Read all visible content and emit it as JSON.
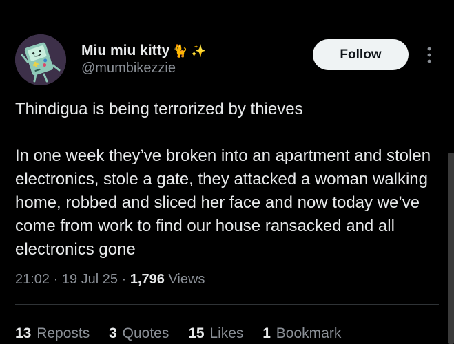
{
  "author": {
    "name": "Miu miu kitty",
    "name_emoji_1": "🐈",
    "name_emoji_2": "✨",
    "handle": "@mumbikezzie",
    "avatar_icon": "bmo-avatar-icon"
  },
  "follow_label": "Follow",
  "more_icon": "more-vertical-icon",
  "tweet": {
    "paragraph_1": "Thindigua is being terrorized by thieves",
    "paragraph_2": "In one week they’ve broken into an apartment and stolen electronics, stole a gate, they attacked a woman walking home, robbed and sliced her face and now today we’ve come from work to find our house ransacked and all electronics gone"
  },
  "meta": {
    "time": "21:02",
    "separator": "·",
    "date": "19 Jul 25",
    "views_count": "1,796",
    "views_label": "Views"
  },
  "stats": {
    "reposts": {
      "count": "13",
      "label": "Reposts"
    },
    "quotes": {
      "count": "3",
      "label": "Quotes"
    },
    "likes": {
      "count": "15",
      "label": "Likes"
    },
    "bookmarks": {
      "count": "1",
      "label": "Bookmark"
    }
  },
  "colors": {
    "background": "#000000",
    "primary_text": "#e7e9ea",
    "secondary_text": "#8b9097",
    "divider": "#2f3336",
    "follow_bg": "#eff3f4",
    "avatar_bg": "#3d3049"
  }
}
